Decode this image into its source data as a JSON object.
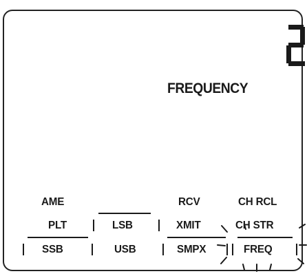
{
  "display": {
    "channel_number": "2",
    "title": "FREQUENCY"
  },
  "labels": {
    "ame": "AME",
    "rcv": "RCV",
    "ch_rcl": "CH RCL",
    "plt": "PLT",
    "lsb": "LSB",
    "xmit": "XMIT",
    "ch_str": "CH STR",
    "ssb": "SSB",
    "usb": "USB",
    "smpx": "SMPX",
    "freq": "FREQ"
  },
  "active_mode": "FREQ"
}
